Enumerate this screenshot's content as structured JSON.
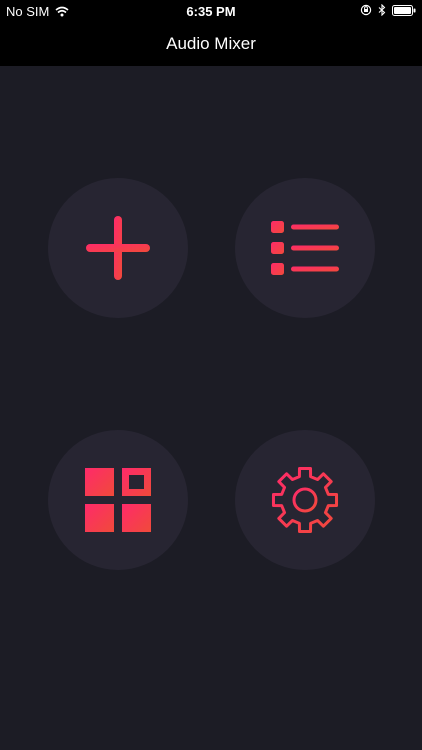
{
  "status_bar": {
    "carrier": "No SIM",
    "time": "6:35 PM",
    "icons": [
      "wifi-icon",
      "orientation-lock-icon",
      "bluetooth-icon",
      "battery-icon"
    ]
  },
  "nav": {
    "title": "Audio Mixer"
  },
  "buttons": [
    {
      "name": "add-button",
      "icon": "plus-icon"
    },
    {
      "name": "list-button",
      "icon": "list-icon"
    },
    {
      "name": "grid-button",
      "icon": "grid-icon"
    },
    {
      "name": "settings-button",
      "icon": "gear-icon"
    }
  ],
  "colors": {
    "background": "#1c1c25",
    "button_fill": "#272532",
    "accent_start": "#ff2a6a",
    "accent_end": "#f04a3a",
    "bar": "#000000"
  }
}
